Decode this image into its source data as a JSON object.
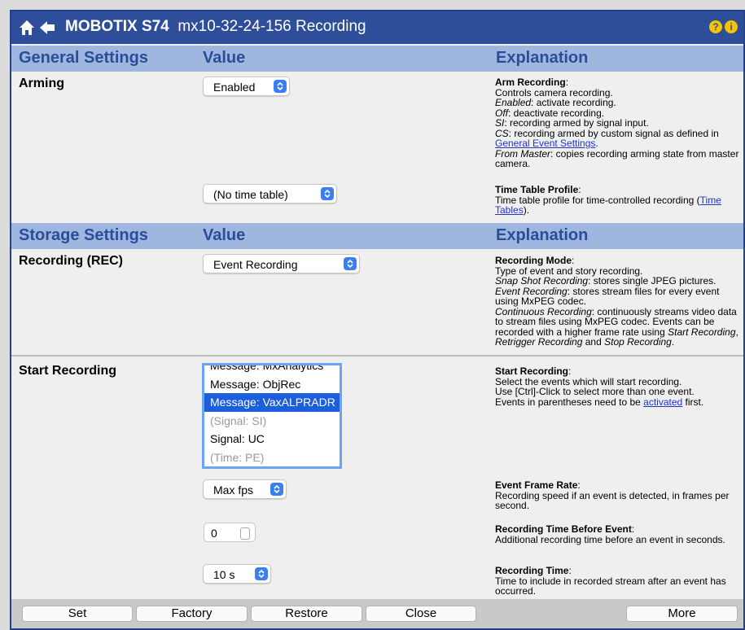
{
  "header": {
    "brand": "MOBOTIX S74",
    "page_title": "mx10-32-24-156 Recording",
    "help_glyph": "?",
    "info_glyph": "i",
    "colors": {
      "titlebar": "#2f4e9a",
      "section": "#9fb6de",
      "section_text": "#2a4d9a"
    }
  },
  "sections": {
    "general": {
      "title": "General Settings",
      "value": "Value",
      "explanation": "Explanation"
    },
    "storage": {
      "title": "Storage Settings",
      "value": "Value",
      "explanation": "Explanation"
    }
  },
  "arming": {
    "label": "Arming",
    "select_value": "Enabled",
    "time_table_value": "(No time table)",
    "expl": {
      "title": "Arm Recording",
      "line1": "Controls camera recording.",
      "enabled_term": "Enabled",
      "enabled_desc": ": activate recording.",
      "off_term": "Off",
      "off_desc": ": deactivate recording.",
      "si_term": "SI",
      "si_desc": ": recording armed by signal input.",
      "cs_term": "CS",
      "cs_desc": ": recording armed by custom signal as defined in",
      "cs_link": "General Event Settings",
      "fm_term": "From Master",
      "fm_desc": ": copies recording arming state from master camera."
    },
    "tt_expl": {
      "title": "Time Table Profile",
      "desc": "Time table profile for time-controlled recording (",
      "link": "Time Tables",
      "end": ")."
    }
  },
  "recording_mode": {
    "label": "Recording (REC)",
    "select_value": "Event Recording",
    "expl": {
      "title": "Recording Mode",
      "line1": "Type of event and story recording.",
      "snap_term": "Snap Shot Recording",
      "snap_desc": ": stores single JPEG pictures.",
      "event_term": "Event Recording",
      "event_desc": ": stores stream files for every event using MxPEG codec.",
      "cont_term": "Continuous Recording",
      "cont_desc": ": continuously streams video data to stream files using MxPEG codec. Events can be recorded with a higher frame rate using",
      "start_term": "Start Recording",
      "sep1": ",",
      "retrig_term": "Retrigger Recording",
      "sep2": "and",
      "stop_term": "Stop Recording",
      "end": "."
    }
  },
  "start_recording": {
    "label": "Start Recording",
    "options": [
      {
        "text": "Message: MxAnalytics",
        "state": "partial"
      },
      {
        "text": "Message: ObjRec",
        "state": "normal"
      },
      {
        "text": "Message: VaxALPRADR",
        "state": "selected"
      },
      {
        "text": "(Signal: SI)",
        "state": "disabled"
      },
      {
        "text": "Signal: UC",
        "state": "normal"
      },
      {
        "text": "(Time: PE)",
        "state": "disabled"
      }
    ],
    "expl": {
      "title": "Start Recording",
      "line1": "Select the events which will start recording.",
      "line2": "Use [Ctrl]-Click to select more than one event.",
      "line3": "Events in parentheses need to be",
      "link": "activated",
      "end": "first."
    }
  },
  "frame_rate": {
    "select_value": "Max fps",
    "expl": {
      "title": "Event Frame Rate",
      "desc": "Recording speed if an event is detected, in frames per second."
    }
  },
  "pre_event": {
    "value": "0",
    "expl": {
      "title": "Recording Time Before Event",
      "desc": "Additional recording time before an event in seconds."
    }
  },
  "rec_time": {
    "select_value": "10 s",
    "expl": {
      "title": "Recording Time",
      "desc": "Time to include in recorded stream after an event has occurred."
    }
  },
  "buttons": {
    "set": "Set",
    "factory": "Factory",
    "restore": "Restore",
    "close": "Close",
    "more": "More"
  }
}
